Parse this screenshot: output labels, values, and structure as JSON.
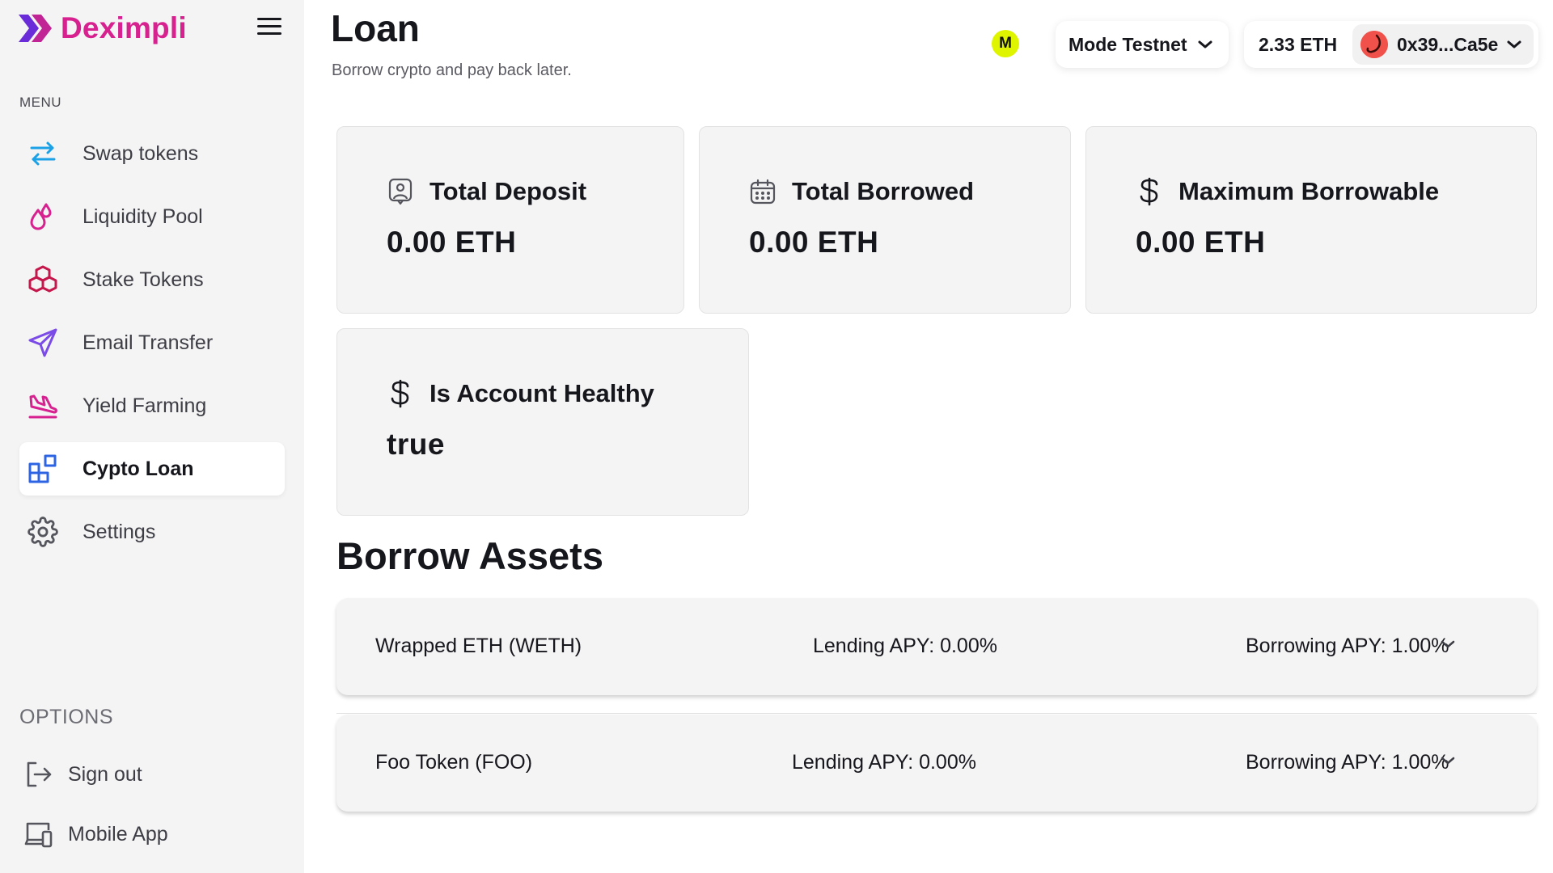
{
  "brand": {
    "name": "Deximpli",
    "color": "#d6218f",
    "logo_color": "#7b2fe0"
  },
  "sidebar": {
    "menu_label": "MENU",
    "items": [
      {
        "label": "Swap tokens",
        "icon": "swap-arrows-icon",
        "active": false
      },
      {
        "label": "Liquidity Pool",
        "icon": "droplets-icon",
        "active": false
      },
      {
        "label": "Stake Tokens",
        "icon": "cubes-icon",
        "active": false
      },
      {
        "label": "Email Transfer",
        "icon": "send-icon",
        "active": false
      },
      {
        "label": "Yield Farming",
        "icon": "plane-landing-icon",
        "active": false
      },
      {
        "label": "Cypto Loan",
        "icon": "blocks-icon",
        "active": true
      },
      {
        "label": "Settings",
        "icon": "gear-icon",
        "active": false
      }
    ],
    "options_label": "OPTIONS",
    "options": [
      {
        "label": "Sign out",
        "icon": "logout-icon"
      },
      {
        "label": "Mobile App",
        "icon": "devices-icon"
      }
    ]
  },
  "header": {
    "title": "Loan",
    "subtitle": "Borrow crypto and pay back later.",
    "mode_badge": "M",
    "network": "Mode Testnet",
    "balance": "2.33 ETH",
    "account": "0x39...Ca5e"
  },
  "stats": {
    "total_deposit": {
      "title": "Total Deposit",
      "value": "0.00 ETH",
      "icon": "user-badge-icon"
    },
    "total_borrowed": {
      "title": "Total Borrowed",
      "value": "0.00 ETH",
      "icon": "calendar-icon"
    },
    "max_borrowable": {
      "title": "Maximum Borrowable",
      "value": "0.00 ETH",
      "icon": "dollar-icon"
    },
    "account_healthy": {
      "title": "Is Account Healthy",
      "value": "true",
      "icon": "dollar-icon"
    }
  },
  "borrow_assets": {
    "title": "Borrow Assets",
    "rows": [
      {
        "name": "Wrapped ETH (WETH)",
        "lending": "Lending APY: 0.00%",
        "borrowing": "Borrowing APY: 1.00%"
      },
      {
        "name": "Foo Token (FOO)",
        "lending": "Lending APY: 0.00%",
        "borrowing": "Borrowing APY: 1.00%"
      }
    ]
  }
}
